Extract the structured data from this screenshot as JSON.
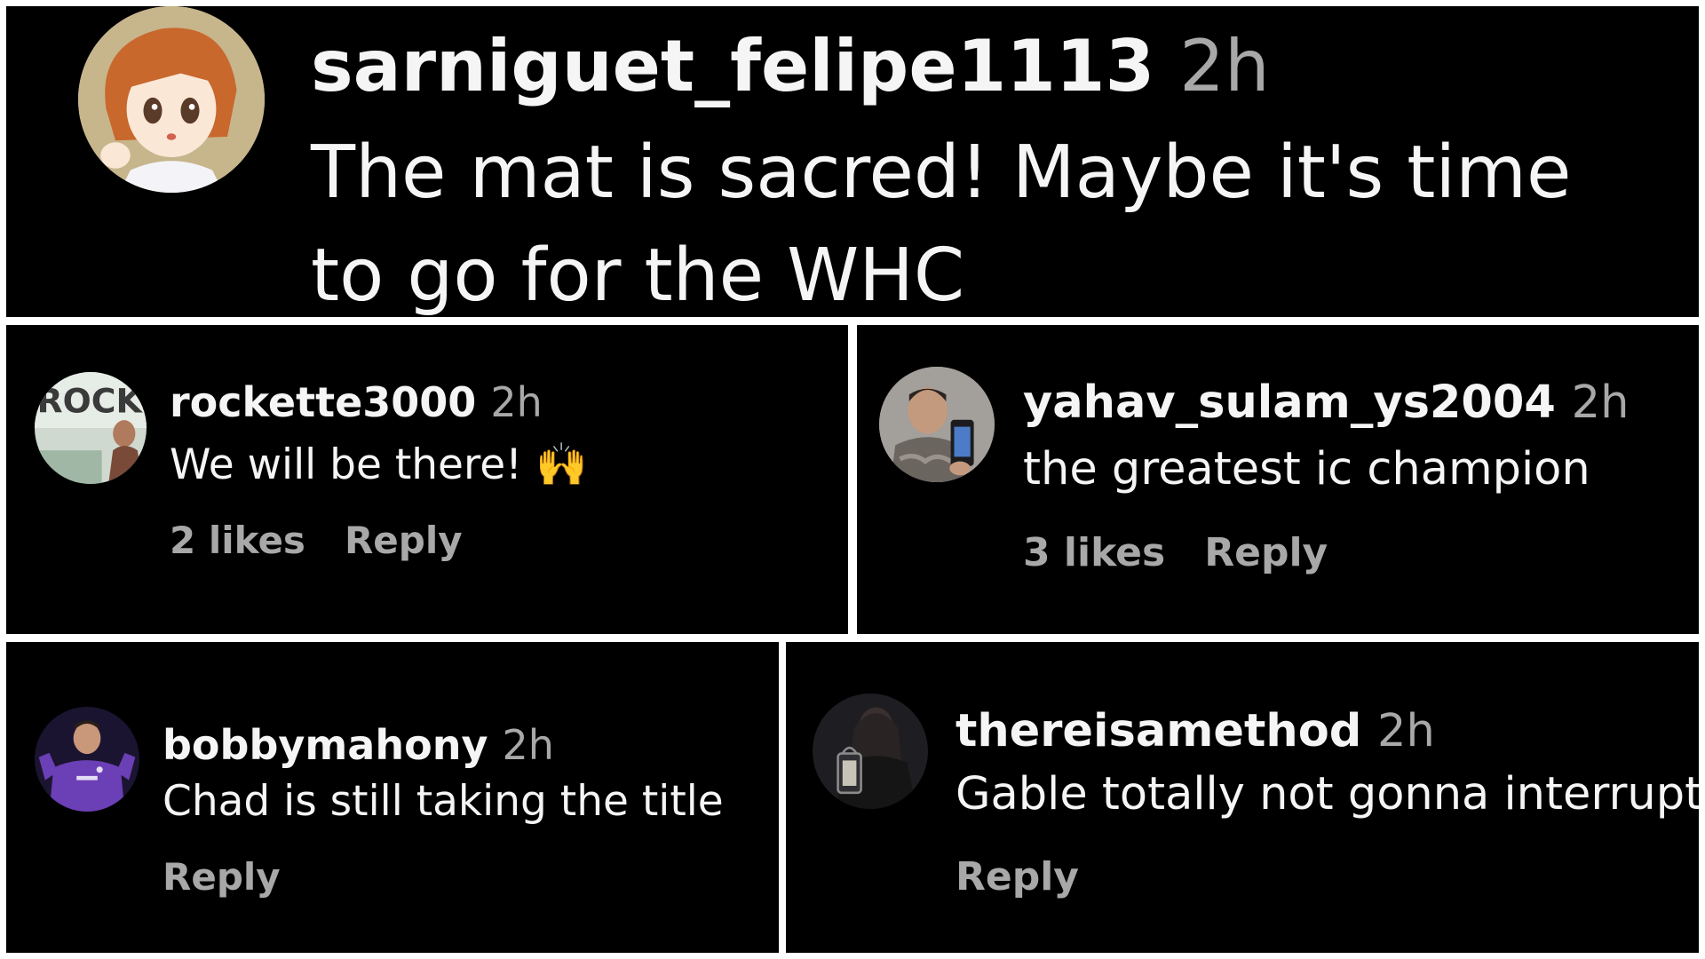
{
  "comments": [
    {
      "username": "sarniguet_felipe1113",
      "time": "2h",
      "text": "The mat is sacred! Maybe it's time to go for the WHC",
      "avatar_icon": "anime-character-avatar"
    },
    {
      "username": "rockette3000",
      "time": "2h",
      "text": "We will be there! 🙌",
      "likes": "2 likes",
      "reply_label": "Reply",
      "avatar_icon": "rock-sign-avatar",
      "avatar_text": "ROCK"
    },
    {
      "username": "yahav_sulam_ys2004",
      "time": "2h",
      "text": "the greatest ic champion",
      "likes": "3 likes",
      "reply_label": "Reply",
      "avatar_icon": "mirror-selfie-avatar"
    },
    {
      "username": "bobbymahony",
      "time": "2h",
      "text": "Chad is still taking the title",
      "reply_label": "Reply",
      "avatar_icon": "purple-jersey-avatar"
    },
    {
      "username": "thereisamethod",
      "time": "2h",
      "text": "Gable totally not gonna interrupt",
      "reply_label": "Reply",
      "avatar_icon": "lantern-figure-avatar"
    }
  ],
  "colors": {
    "background": "#000000",
    "divider": "#ffffff",
    "primary_text": "#f5f5f5",
    "secondary_text": "#a8a8a8"
  }
}
